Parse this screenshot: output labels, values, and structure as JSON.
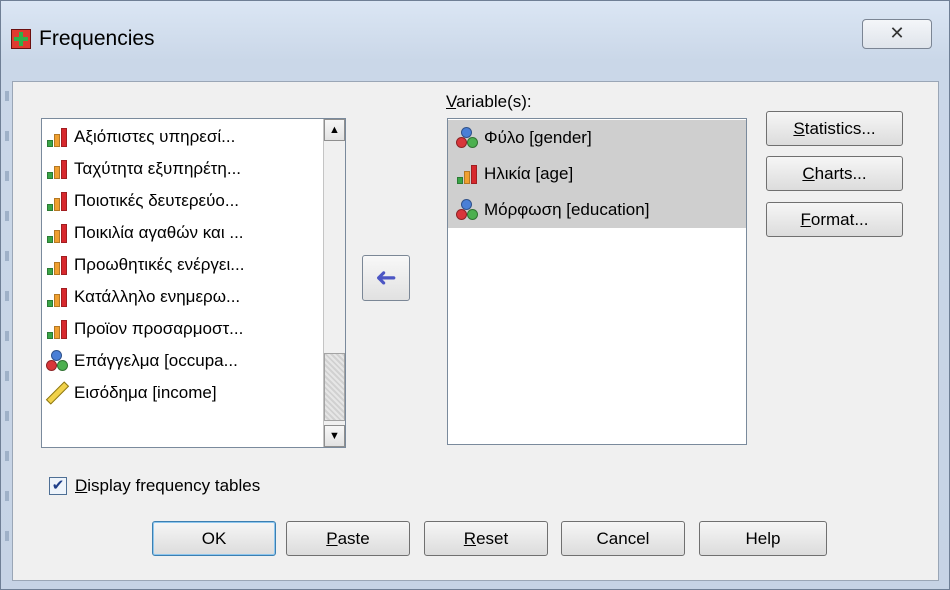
{
  "window": {
    "title": "Frequencies",
    "close_glyph": "✕"
  },
  "source_list": {
    "items": [
      {
        "label": "Αξιόπιστες υπηρεσί...",
        "icon": "ordinal-bar-icon"
      },
      {
        "label": "Ταχύτητα εξυπηρέτη...",
        "icon": "ordinal-bar-icon"
      },
      {
        "label": "Ποιοτικές δευτερεύο...",
        "icon": "ordinal-bar-icon"
      },
      {
        "label": "Ποικιλία αγαθών και ...",
        "icon": "ordinal-bar-icon"
      },
      {
        "label": "Προωθητικές ενέργει...",
        "icon": "ordinal-bar-icon"
      },
      {
        "label": "Κατάλληλο ενημερω...",
        "icon": "ordinal-bar-icon"
      },
      {
        "label": "Προϊον προσαρμοστ...",
        "icon": "ordinal-bar-icon"
      },
      {
        "label": "Επάγγελμα [occupa...",
        "icon": "nominal-icon"
      },
      {
        "label": "Εισόδημα [income]",
        "icon": "scale-ruler-icon"
      }
    ],
    "scroll_up_glyph": "▲",
    "scroll_down_glyph": "▼"
  },
  "move_button_glyph": "➜",
  "target": {
    "label_prefix": "",
    "label_accel": "V",
    "label_rest": "ariable(s):",
    "items": [
      {
        "label": "Φύλο  [gender]",
        "icon": "nominal-icon"
      },
      {
        "label": "Ηλικία [age]",
        "icon": "ordinal-bar-icon"
      },
      {
        "label": "Μόρφωση [education]",
        "icon": "nominal-icon"
      }
    ]
  },
  "side_buttons": {
    "statistics": {
      "accel": "S",
      "rest": "tatistics..."
    },
    "charts": {
      "accel": "C",
      "rest": "harts..."
    },
    "format": {
      "accel": "F",
      "rest": "ormat..."
    }
  },
  "checkbox": {
    "checked": true,
    "check_glyph": "✔",
    "accel": "D",
    "rest": "isplay frequency tables"
  },
  "bottom_buttons": {
    "ok": "OK",
    "paste_accel": "P",
    "paste_rest": "aste",
    "reset_accel": "R",
    "reset_rest": "eset",
    "cancel": "Cancel",
    "help": "Help"
  },
  "colors": {
    "selection": "#cfcfcf",
    "accent_arrow": "#4c56c4"
  }
}
